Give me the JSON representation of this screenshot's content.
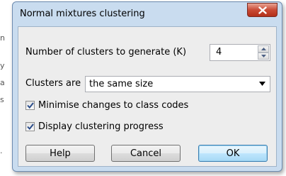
{
  "background": {
    "fragments": [
      "n",
      "y",
      "a",
      "s",
      "."
    ]
  },
  "dialog": {
    "title": "Normal mixtures clustering",
    "close_symbol": "X",
    "clusters_label": "Number of clusters to generate (K)",
    "clusters_value": "4",
    "clusters_are_label": "Clusters are",
    "clusters_are_value": "the same size",
    "minimise_label": "Minimise changes to class codes",
    "minimise_checked": true,
    "display_label": "Display clustering progress",
    "display_checked": true,
    "buttons": {
      "help": "Help",
      "cancel": "Cancel",
      "ok": "OK"
    }
  },
  "colors": {
    "frame": "#c9dcef",
    "close_button": "#c94a35",
    "client": "#ededed",
    "default_button_border": "#3c7fb1"
  }
}
